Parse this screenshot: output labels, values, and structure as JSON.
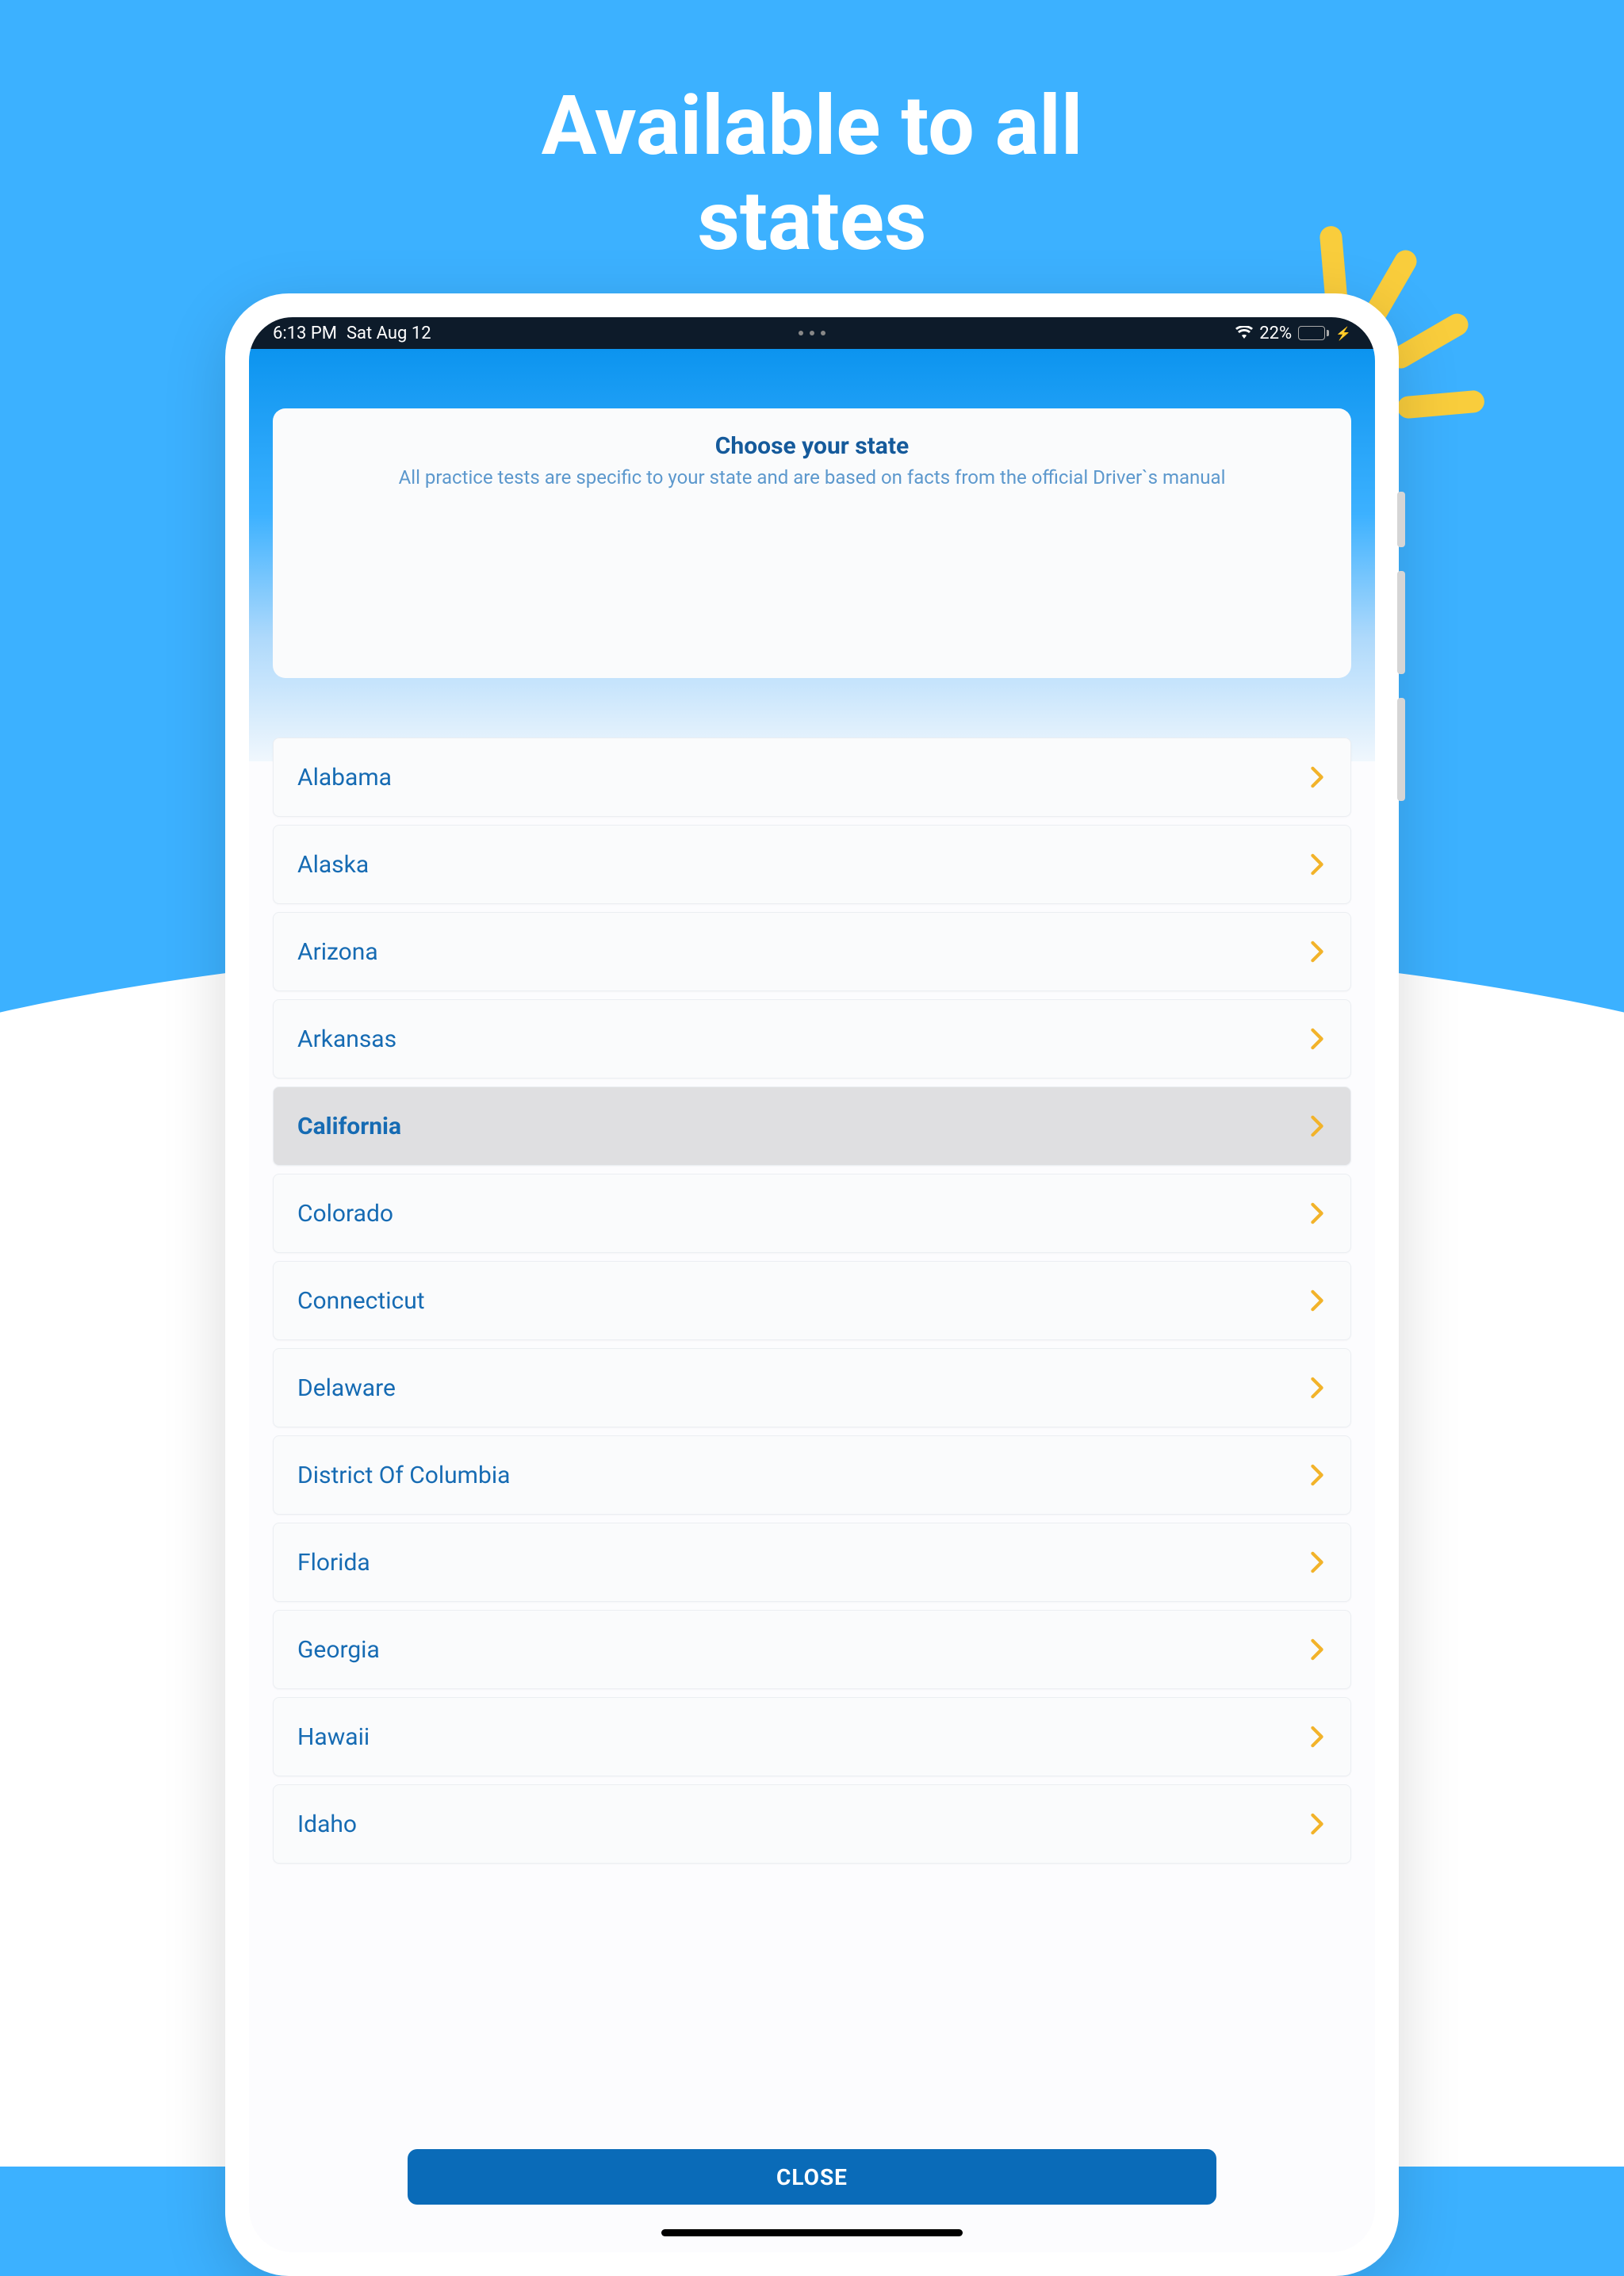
{
  "promo": {
    "title_line1": "Available to all",
    "title_line2": "states"
  },
  "status_bar": {
    "time": "6:13 PM",
    "date": "Sat Aug 12",
    "battery_pct": "22%"
  },
  "header_card": {
    "title": "Choose your state",
    "subtitle": "All practice tests are specific to your state and are based on facts from the official Driver`s manual"
  },
  "states": [
    {
      "name": "Alabama",
      "selected": false
    },
    {
      "name": "Alaska",
      "selected": false
    },
    {
      "name": "Arizona",
      "selected": false
    },
    {
      "name": "Arkansas",
      "selected": false
    },
    {
      "name": "California",
      "selected": true
    },
    {
      "name": "Colorado",
      "selected": false
    },
    {
      "name": "Connecticut",
      "selected": false
    },
    {
      "name": "Delaware",
      "selected": false
    },
    {
      "name": "District Of Columbia",
      "selected": false
    },
    {
      "name": "Florida",
      "selected": false
    },
    {
      "name": "Georgia",
      "selected": false
    },
    {
      "name": "Hawaii",
      "selected": false
    },
    {
      "name": "Idaho",
      "selected": false
    }
  ],
  "footer": {
    "close_label": "CLOSE"
  },
  "colors": {
    "accent_blue": "#3cb1ff",
    "primary_blue": "#0a6bb8",
    "text_blue": "#166bb3",
    "chevron_yellow": "#f2b32a"
  }
}
